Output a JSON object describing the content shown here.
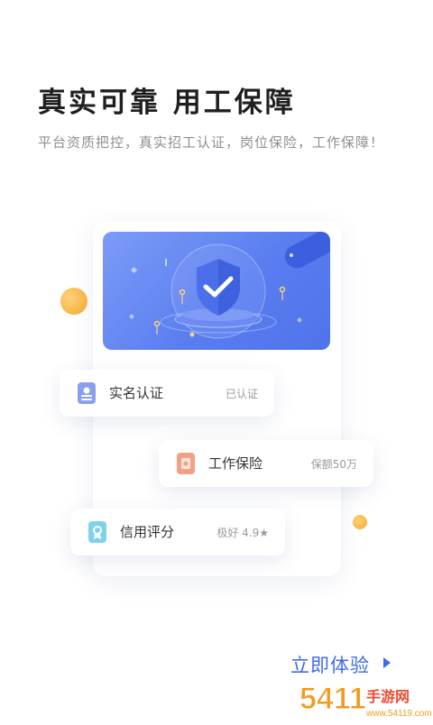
{
  "header": {
    "title": "真实可靠  用工保障",
    "subtitle": "平台资质把控，真实招工认证，岗位保险，工作保障！"
  },
  "verification_cards": [
    {
      "label": "实名认证",
      "value": "已认证",
      "icon": "id-card-icon",
      "color": "#6f86e0"
    },
    {
      "label": "工作保险",
      "value": "保额50万",
      "icon": "insurance-icon",
      "color": "#f08a6f"
    },
    {
      "label": "信用评分",
      "value": "极好 4.9★",
      "icon": "credit-icon",
      "color": "#5ec4e8"
    }
  ],
  "cta": {
    "label": "立即体验"
  },
  "watermark": {
    "brand": "54119手游网",
    "domain": "www.54119.com"
  },
  "colors": {
    "accent": "#3e6be8",
    "banner": "#5a7ef0",
    "orange_dot": "#f7b53a"
  }
}
